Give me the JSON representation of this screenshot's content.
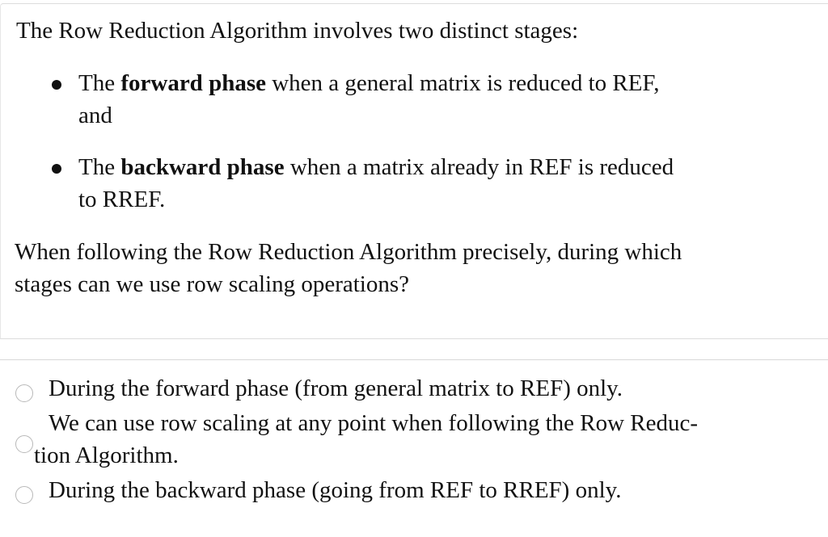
{
  "question": {
    "intro": "The Row Reduction Algorithm involves two distinct stages:",
    "bullets": [
      {
        "prefix": "The ",
        "bold": "forward phase",
        "line1_rest": " when a general matrix is reduced to REF,",
        "line2": "and"
      },
      {
        "prefix": "The ",
        "bold": "backward phase",
        "line1_rest": " when a matrix already in REF is reduced",
        "line2": "to RREF."
      }
    ],
    "prompt_line1": "When following the Row Reduction Algorithm precisely, during which",
    "prompt_line2": "stages can we use row scaling operations?"
  },
  "answers": {
    "options": [
      {
        "line1": "During the forward phase (from general matrix to REF) only.",
        "selected": false
      },
      {
        "line1": "We can use row scaling at any point when following the Row Reduc-",
        "line2": "tion Algorithm.",
        "selected": false
      },
      {
        "line1": "During the backward phase (going from REF to RREF) only.",
        "selected": false
      }
    ]
  }
}
